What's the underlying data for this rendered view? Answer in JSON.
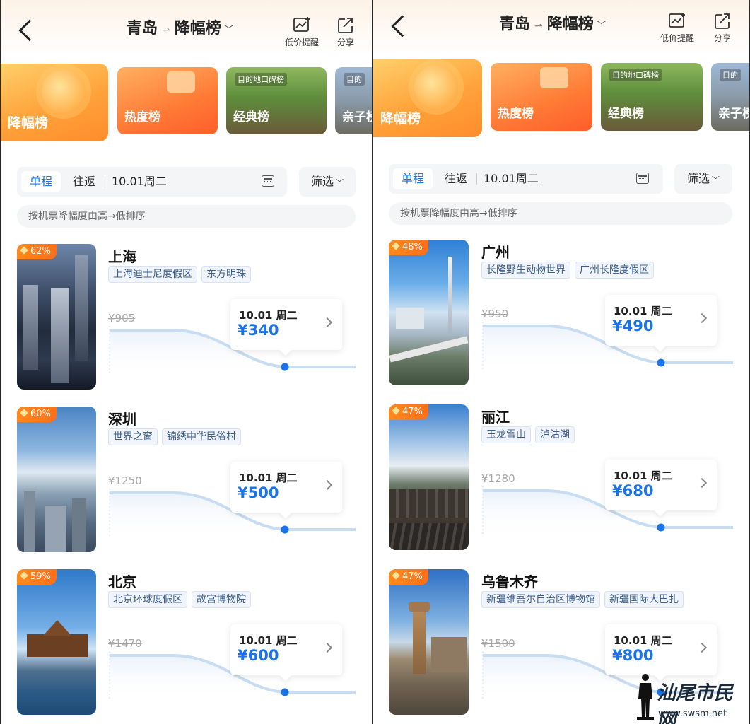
{
  "header": {
    "origin": "青岛",
    "list_name": "降幅榜",
    "price_alert_label": "低价提醒",
    "share_label": "分享"
  },
  "rank_cards": [
    {
      "label": "降幅榜"
    },
    {
      "label": "热度榜"
    },
    {
      "label": "经典榜",
      "sign": "目的地口碑榜"
    },
    {
      "label": "亲子榜",
      "sign": "目的"
    }
  ],
  "search": {
    "one_way_label": "单程",
    "round_trip_label": "往返",
    "date": "10.01周二",
    "filter_label": "筛选"
  },
  "sort_hint": "按机票降幅度由高→低排序",
  "left_panel": {
    "items": [
      {
        "badge": "62%",
        "city": "上海",
        "tags": [
          "上海迪士尼度假区",
          "东方明珠"
        ],
        "original_price": "¥905",
        "date": "10.01 周二",
        "price": "¥340"
      },
      {
        "badge": "60%",
        "city": "深圳",
        "tags": [
          "世界之窗",
          "锦绣中华民俗村"
        ],
        "original_price": "¥1250",
        "date": "10.01 周二",
        "price": "¥500"
      },
      {
        "badge": "59%",
        "city": "北京",
        "tags": [
          "北京环球度假区",
          "故宫博物院"
        ],
        "original_price": "¥1470",
        "date": "10.01 周二",
        "price": "¥600"
      }
    ]
  },
  "right_panel": {
    "items": [
      {
        "badge": "48%",
        "city": "广州",
        "tags": [
          "长隆野生动物世界",
          "广州长隆度假区"
        ],
        "original_price": "¥950",
        "date": "10.01 周二",
        "price": "¥490"
      },
      {
        "badge": "47%",
        "city": "丽江",
        "tags": [
          "玉龙雪山",
          "泸沽湖"
        ],
        "original_price": "¥1280",
        "date": "10.01 周二",
        "price": "¥680"
      },
      {
        "badge": "47%",
        "city": "乌鲁木齐",
        "tags": [
          "新疆维吾尔自治区博物馆",
          "新疆国际大巴扎"
        ],
        "original_price": "¥1500",
        "date": "10.01 周二",
        "price": "¥800"
      }
    ]
  },
  "watermark": {
    "brand": "汕尾市民网",
    "url": "www.swsm.net"
  },
  "colors": {
    "accent_blue": "#1a73e8",
    "badge_orange": "#ff7a1a",
    "trend_line": "#c8dcf2"
  }
}
